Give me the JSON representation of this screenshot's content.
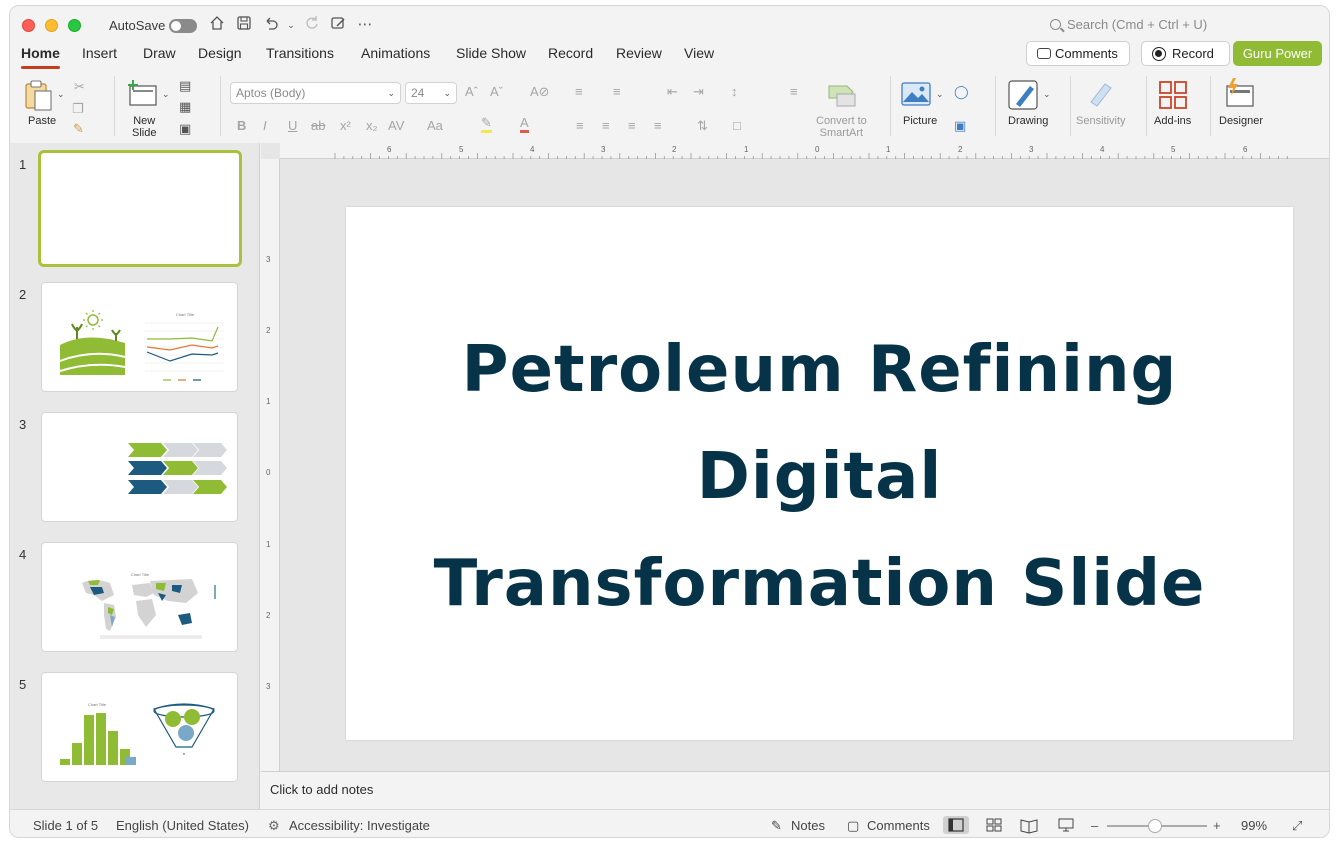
{
  "titlebar": {
    "autosave_label": "AutoSave",
    "search_placeholder": "Search (Cmd + Ctrl + U)"
  },
  "tabs": [
    "Home",
    "Insert",
    "Draw",
    "Design",
    "Transitions",
    "Animations",
    "Slide Show",
    "Record",
    "Review",
    "View"
  ],
  "actions": {
    "comments": "Comments",
    "record": "Record",
    "guru": "Guru Power"
  },
  "ribbon": {
    "paste": "Paste",
    "new_slide": "New\nSlide",
    "font_name": "Aptos (Body)",
    "font_size": "24",
    "convert_smartart": "Convert to\nSmartArt",
    "picture": "Picture",
    "drawing": "Drawing",
    "sensitivity": "Sensitivity",
    "addins": "Add-ins",
    "designer": "Designer"
  },
  "thumbnails": [
    "1",
    "2",
    "3",
    "4",
    "5"
  ],
  "thumb_text": {
    "chart_title": "Chart Title"
  },
  "slide": {
    "title_line1": "Petroleum Refining",
    "title_line2": "Digital",
    "title_line3": "Transformation Slide"
  },
  "notes_placeholder": "Click to add notes",
  "status": {
    "slide_of": "Slide 1 of 5",
    "language": "English (United States)",
    "accessibility": "Accessibility: Investigate",
    "notes": "Notes",
    "comments": "Comments",
    "zoom": "99%"
  },
  "colors": {
    "accent_green": "#8fbc34",
    "title_navy": "#073349",
    "tab_underline": "#c43e1c"
  }
}
